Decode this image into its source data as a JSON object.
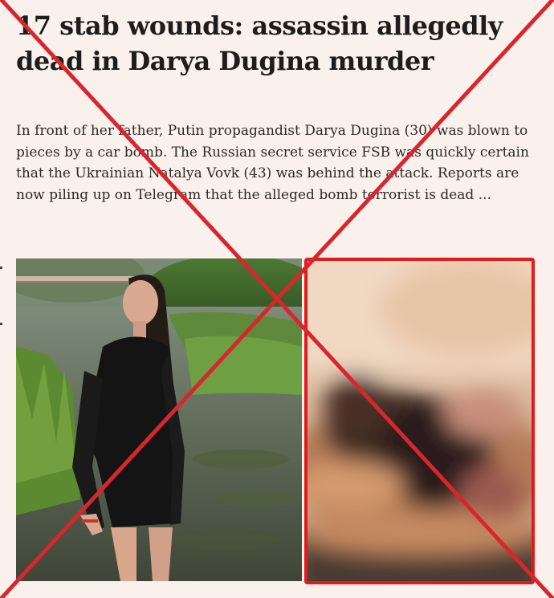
{
  "article": {
    "headline": "17 stab wounds: assassin allegedly dead in Darya Dugina murder",
    "lede": "In front of her father, Putin propagandist Darya Dugina (30) was blown to pieces by a car bomb. The Russian secret service FSB was quickly certain that the Ukrainian Natalya Vovk (43) was behind the attack. Reports are now piling up on Telegram that the alleged bomb terrorist is dead ..."
  },
  "images": {
    "left_photo": "woman-in-black-dress-by-river-photo",
    "right_photo": "blurred-photo"
  },
  "overlay": {
    "cross_color": "#d8262c",
    "frame_color": "#e01b1b"
  }
}
